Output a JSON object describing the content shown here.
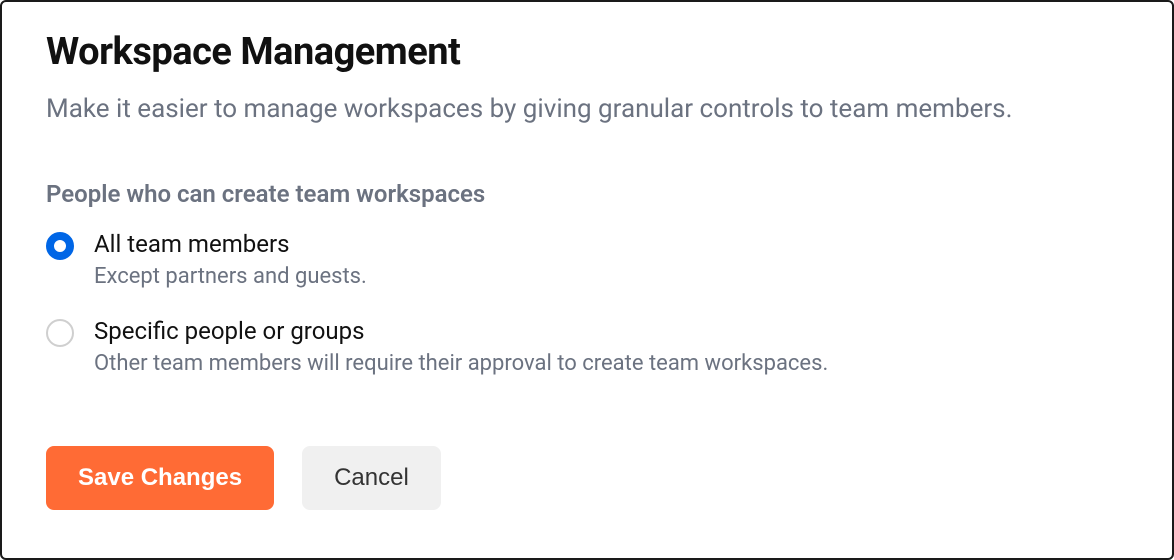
{
  "header": {
    "title": "Workspace Management",
    "subtitle": "Make it easier to manage workspaces by giving granular controls to team members."
  },
  "section": {
    "label": "People who can create team workspaces",
    "options": [
      {
        "label": "All team members",
        "description": "Except partners and guests.",
        "selected": true
      },
      {
        "label": "Specific people or groups",
        "description": "Other team members will require their approval to create team workspaces.",
        "selected": false
      }
    ]
  },
  "buttons": {
    "save": "Save Changes",
    "cancel": "Cancel"
  },
  "colors": {
    "accent": "#ff6b35",
    "radio_selected": "#0066e6",
    "text_primary": "#111",
    "text_secondary": "#6b7280"
  }
}
